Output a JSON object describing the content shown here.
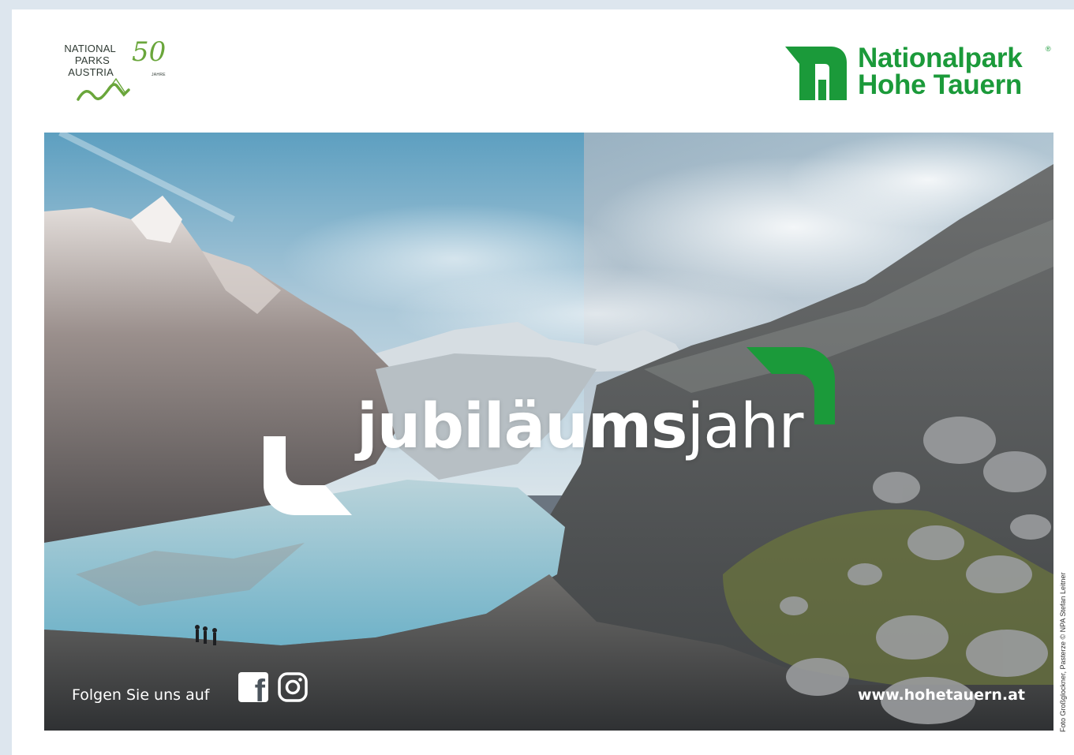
{
  "header": {
    "np_austria": {
      "line1": "NATIONAL",
      "line2": "PARKS",
      "line3": "AUSTRIA",
      "anniversary": "50",
      "anniversary_sub": "JAHRE"
    },
    "nht": {
      "line1": "Nationalpark",
      "line2": "Hohe Tauern",
      "registered": "®"
    }
  },
  "banner": {
    "headline_bold": "jubiläums",
    "headline_light": "jahr",
    "follow_text": "Folgen Sie uns auf",
    "social": [
      "facebook-icon",
      "instagram-icon"
    ],
    "website": "www.hohetauern.at"
  },
  "photo_credit": "Foto Großglockner, Pasterze © NPA Stefan Leitner",
  "colors": {
    "brand_green": "#1b9a3a",
    "austria_green": "#6aa63b",
    "background": "#dde6ee"
  }
}
